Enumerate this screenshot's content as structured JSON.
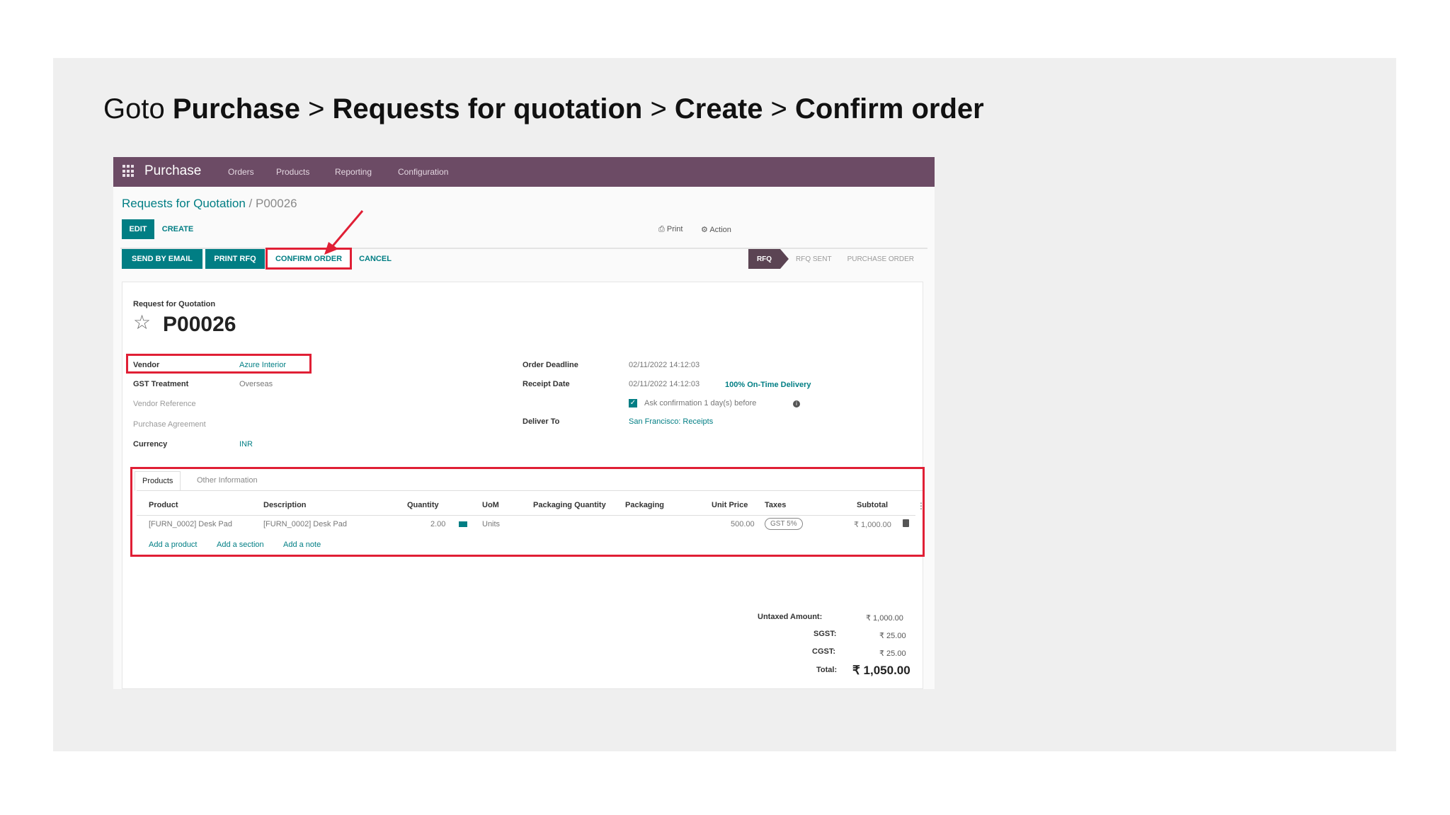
{
  "slide": {
    "title": {
      "prefix": "Goto ",
      "step1": "Purchase",
      "sep1": " > ",
      "step2": "Requests for quotation",
      "sep2": " > ",
      "step3": "Create",
      "sep3": " > ",
      "step4": "Confirm order"
    }
  },
  "navbar": {
    "app_name": "Purchase",
    "menu": [
      "Orders",
      "Products",
      "Reporting",
      "Configuration"
    ]
  },
  "breadcrumb": {
    "parent": "Requests for Quotation",
    "separator": " / ",
    "current": "P00026"
  },
  "control_panel": {
    "edit_label": "EDIT",
    "create_label": "CREATE",
    "print_label": "Print",
    "action_label": "Action"
  },
  "header_buttons": {
    "send_email": "SEND BY EMAIL",
    "print_rfq": "PRINT RFQ",
    "confirm_order": "CONFIRM ORDER",
    "cancel": "CANCEL"
  },
  "statusbar": {
    "current": "RFQ",
    "steps": [
      "RFQ SENT",
      "PURCHASE ORDER"
    ]
  },
  "form": {
    "doc_label": "Request for Quotation",
    "doc_name": "P00026",
    "left_fields": {
      "vendor": {
        "label": "Vendor",
        "value": "Azure Interior"
      },
      "gst": {
        "label": "GST Treatment",
        "value": "Overseas"
      },
      "vendor_ref": {
        "label": "Vendor Reference"
      },
      "agreement": {
        "label": "Purchase Agreement"
      },
      "currency": {
        "label": "Currency",
        "value": "INR"
      }
    },
    "right_fields": {
      "order_deadline": {
        "label": "Order Deadline",
        "value": "02/11/2022 14:12:03"
      },
      "receipt_date": {
        "label": "Receipt Date",
        "value": "02/11/2022 14:12:03",
        "ontime": "100% On-Time Delivery"
      },
      "ask_confirmation": {
        "text": "Ask confirmation  1  day(s) before",
        "checked": true
      },
      "deliver_to": {
        "label": "Deliver To",
        "value": "San Francisco: Receipts"
      }
    }
  },
  "tabs": [
    "Products",
    "Other Information"
  ],
  "lines_table": {
    "columns": [
      "Product",
      "Description",
      "Quantity",
      "UoM",
      "Packaging Quantity",
      "Packaging",
      "Unit Price",
      "Taxes",
      "Subtotal"
    ],
    "rows": [
      {
        "product": "[FURN_0002] Desk Pad",
        "description": "[FURN_0002] Desk Pad",
        "quantity": "2.00",
        "uom": "Units",
        "unit_price": "500.00",
        "taxes": "GST 5%",
        "subtotal": "₹ 1,000.00"
      }
    ],
    "add_links": [
      "Add a product",
      "Add a section",
      "Add a note"
    ]
  },
  "totals": {
    "untaxed": {
      "label": "Untaxed Amount:",
      "value": "₹ 1,000.00"
    },
    "sgst": {
      "label": "SGST:",
      "value": "₹ 25.00"
    },
    "cgst": {
      "label": "CGST:",
      "value": "₹ 25.00"
    },
    "total": {
      "label": "Total:",
      "value": "₹ 1,050.00"
    }
  },
  "colors": {
    "brand": "#6c4b65",
    "accent": "#017e84",
    "highlight": "#e01f35"
  }
}
